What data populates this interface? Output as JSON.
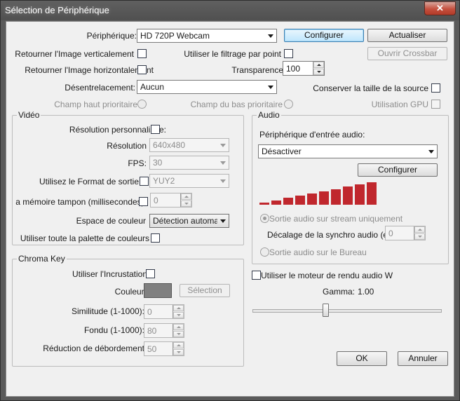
{
  "window": {
    "title": "Sélection de Périphérique",
    "close_glyph": "✕"
  },
  "top": {
    "device_label": "Périphérique:",
    "device_value": "HD 720P Webcam",
    "configure_label": "Configurer",
    "refresh_label": "Actualiser",
    "flip_vertical_label": "Retourner l'Image verticalement",
    "point_filter_label": "Utiliser le filtrage par point",
    "open_crossbar_label": "Ouvrir Crossbar",
    "flip_horizontal_label": "Retourner l'Image horizontalement",
    "transparency_label": "Transparence",
    "transparency_value": "100",
    "deinterlace_label": "Désentrelacement:",
    "deinterlace_value": "Aucun",
    "keep_source_size_label": "Conserver la taille de la source",
    "upper_field_label": "Champ haut prioritaire",
    "lower_field_label": "Champ du bas prioritaire",
    "use_gpu_label": "Utilisation GPU"
  },
  "video": {
    "group_title": "Vidéo",
    "custom_res_label": "Résolution personnalisée:",
    "resolution_label": "Résolution",
    "resolution_value": "640x480",
    "fps_label": "FPS:",
    "fps_value": "30",
    "output_format_label": "Utilisez le Format de sortie",
    "output_format_value": "YUY2",
    "buffer_label": "a mémoire tampon (millisecondes):",
    "buffer_value": "0",
    "colorspace_label": "Espace de couleur",
    "colorspace_value": "Détection automa",
    "full_palette_label": "Utiliser toute la palette de couleurs"
  },
  "audio": {
    "group_title": "Audio",
    "input_device_label": "Périphérique d'entrée audio:",
    "input_device_value": "Désactiver",
    "configure_label": "Configurer",
    "meter_levels": [
      0.1,
      0.2,
      0.3,
      0.4,
      0.5,
      0.6,
      0.7,
      0.8,
      0.9,
      1.0
    ],
    "meter_color": "#c0272d",
    "output_stream_only_label": "Sortie audio sur stream uniquement",
    "sync_offset_label": "Décalage de la synchro audio (en",
    "sync_offset_value": "0",
    "output_desktop_label": "Sortie audio sur le Bureau"
  },
  "chroma": {
    "group_title": "Chroma Key",
    "use_key_label": "Utiliser l'Incrustation",
    "color_label": "Couleur:",
    "color_value": "#808080",
    "select_label": "Sélection",
    "similarity_label": "Similitude (1-1000):",
    "similarity_value": "0",
    "blend_label": "Fondu (1-1000):",
    "blend_value": "80",
    "spill_label": "Réduction de débordement",
    "spill_value": "50"
  },
  "bottom": {
    "wave_renderer_label": "Utiliser le moteur de rendu audio W",
    "gamma_label": "Gamma:",
    "gamma_value": "1.00",
    "gamma_position": 0.39,
    "ok_label": "OK",
    "cancel_label": "Annuler"
  }
}
